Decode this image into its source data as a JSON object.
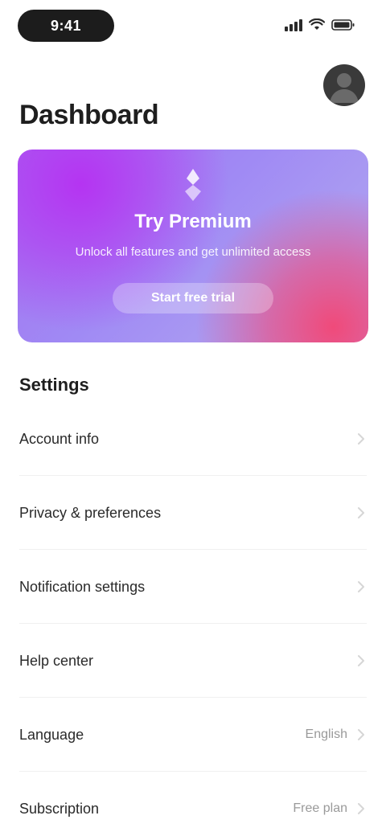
{
  "status_bar": {
    "time": "9:41"
  },
  "header": {
    "title": "Dashboard"
  },
  "promo": {
    "headline": "Try Premium",
    "subtext": "Unlock all features and get unlimited access",
    "button_label": "Start free trial"
  },
  "settings": {
    "section_title": "Settings",
    "items": [
      {
        "label": "Account info",
        "value": ""
      },
      {
        "label": "Privacy & preferences",
        "value": ""
      },
      {
        "label": "Notification settings",
        "value": ""
      },
      {
        "label": "Help center",
        "value": ""
      },
      {
        "label": "Language",
        "value": "English"
      },
      {
        "label": "Subscription",
        "value": "Free plan"
      }
    ]
  },
  "colors": {
    "accent_purple": "#a46cf0",
    "accent_magenta": "#b534f2",
    "accent_pink": "#f04a7a"
  },
  "icons": {
    "avatar": "user-avatar",
    "promo": "premium-logo-icon",
    "row": "chevron-right-icon"
  }
}
